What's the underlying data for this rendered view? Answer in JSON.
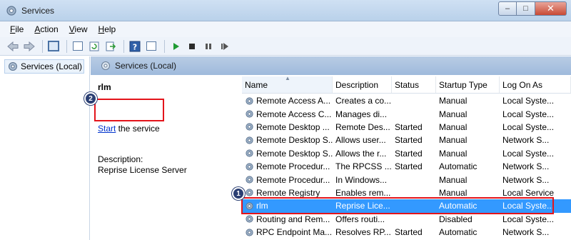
{
  "window": {
    "title": "Services"
  },
  "menu": [
    {
      "label": "File",
      "u": "F",
      "rest": "ile"
    },
    {
      "label": "Action",
      "u": "A",
      "rest": "ction"
    },
    {
      "label": "View",
      "u": "V",
      "rest": "iew"
    },
    {
      "label": "Help",
      "u": "H",
      "rest": "elp"
    }
  ],
  "tree": {
    "root_label": "Services (Local)"
  },
  "pane_header": {
    "title": "Services (Local)"
  },
  "details": {
    "service_name": "rlm",
    "start_link": "Start",
    "start_rest": " the service",
    "description_label": "Description:",
    "description_text": "Reprise License Server"
  },
  "callouts": {
    "badge1": "1",
    "badge2": "2"
  },
  "table": {
    "columns": [
      "Name",
      "Description",
      "Status",
      "Startup Type",
      "Log On As"
    ],
    "rows": [
      {
        "name": "Remote Access A...",
        "desc": "Creates a co...",
        "status": "",
        "startup": "Manual",
        "logon": "Local Syste...",
        "selected": false
      },
      {
        "name": "Remote Access C...",
        "desc": "Manages di...",
        "status": "",
        "startup": "Manual",
        "logon": "Local Syste...",
        "selected": false
      },
      {
        "name": "Remote Desktop ...",
        "desc": "Remote Des...",
        "status": "Started",
        "startup": "Manual",
        "logon": "Local Syste...",
        "selected": false
      },
      {
        "name": "Remote Desktop S...",
        "desc": "Allows user...",
        "status": "Started",
        "startup": "Manual",
        "logon": "Network S...",
        "selected": false
      },
      {
        "name": "Remote Desktop S...",
        "desc": "Allows the r...",
        "status": "Started",
        "startup": "Manual",
        "logon": "Local Syste...",
        "selected": false
      },
      {
        "name": "Remote Procedur...",
        "desc": "The RPCSS ...",
        "status": "Started",
        "startup": "Automatic",
        "logon": "Network S...",
        "selected": false
      },
      {
        "name": "Remote Procedur...",
        "desc": "In Windows...",
        "status": "",
        "startup": "Manual",
        "logon": "Network S...",
        "selected": false
      },
      {
        "name": "Remote Registry",
        "desc": "Enables rem...",
        "status": "",
        "startup": "Manual",
        "logon": "Local Service",
        "selected": false
      },
      {
        "name": "rlm",
        "desc": "Reprise Lice...",
        "status": "",
        "startup": "Automatic",
        "logon": "Local Syste...",
        "selected": true
      },
      {
        "name": "Routing and Rem...",
        "desc": "Offers routi...",
        "status": "",
        "startup": "Disabled",
        "logon": "Local Syste...",
        "selected": false
      },
      {
        "name": "RPC Endpoint Ma...",
        "desc": "Resolves RP...",
        "status": "Started",
        "startup": "Automatic",
        "logon": "Network S...",
        "selected": false
      }
    ]
  },
  "colors": {
    "selection": "#3399ff",
    "callout": "#e3141b",
    "badge": "#2b3f73",
    "link": "#0033cc"
  },
  "icons": [
    "services-app-icon",
    "back-icon",
    "forward-icon",
    "console-tree-icon",
    "properties-icon",
    "refresh-icon",
    "export-icon",
    "help-icon",
    "view-icon",
    "play-icon",
    "stop-icon",
    "pause-icon",
    "restart-icon",
    "gear-icon"
  ]
}
